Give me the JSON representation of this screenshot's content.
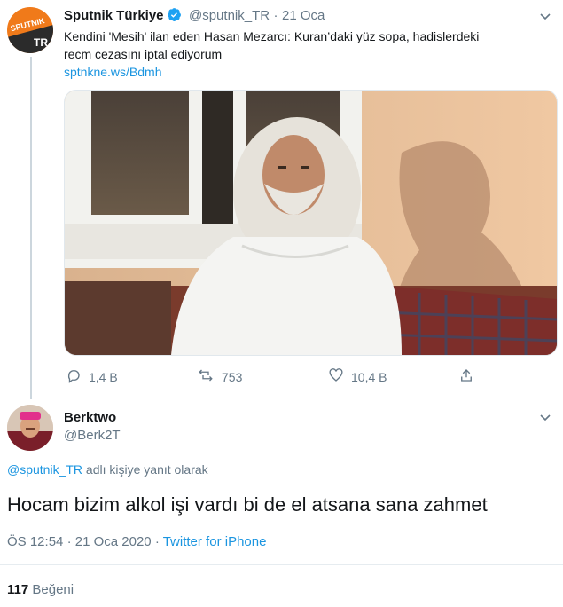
{
  "quoted_tweet": {
    "display_name": "Sputnik Türkiye",
    "handle": "@sputnik_TR",
    "separator": "·",
    "date": "21 Oca",
    "text_line1": "Kendini 'Mesih' ilan eden Hasan Mezarcı: Kuran’daki yüz sopa, hadislerdeki",
    "text_line2": "recm cezasını iptal ediyorum",
    "link": "sptnkne.ws/Bdmh",
    "avatar_logo_top": "SPUTNIK",
    "avatar_logo_bottom": "TR",
    "replies": "1,4 B",
    "retweets": "753",
    "likes": "10,4 B"
  },
  "reply_tweet": {
    "display_name": "Berktwo",
    "handle": "@Berk2T",
    "reply_to_handle": "@sputnik_TR",
    "reply_to_suffix": "adlı kişiye yanıt olarak",
    "text": "Hocam bizim alkol işi vardı bi de el atsana sana zahmet",
    "time": "ÖS 12:54",
    "date": "21 Oca 2020",
    "dot": "·",
    "source": "Twitter for iPhone",
    "likes_count": "117",
    "likes_label": "Beğeni"
  },
  "colors": {
    "accent": "#1b95e0",
    "verified": "#1da1f2",
    "sputnik_orange": "#f07a1a",
    "muted": "#657786"
  }
}
